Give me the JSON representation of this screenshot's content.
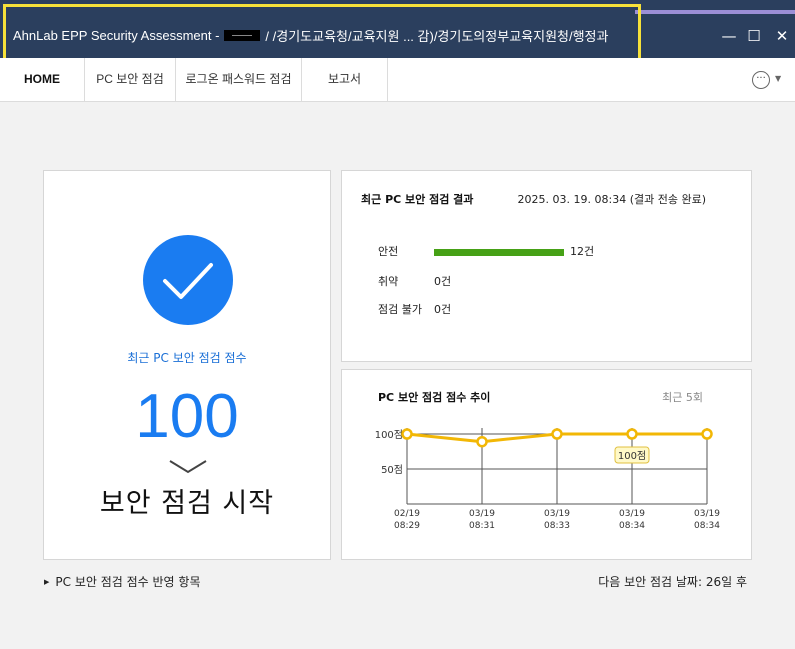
{
  "window": {
    "title_prefix": "AhnLab EPP Security Assessment -",
    "title_suffix": "/ /경기도교육청/교육지원 ... 감)/경기도의정부교육지원청/행정과",
    "minimize_glyph": "—",
    "maximize_glyph": "☐",
    "close_glyph": "✕"
  },
  "tabs": [
    {
      "label": "HOME"
    },
    {
      "label": "PC 보안 점검"
    },
    {
      "label": "로그온 패스워드 점검"
    },
    {
      "label": "보고서"
    }
  ],
  "more_menu": {
    "glyph": "···",
    "caret": "▼"
  },
  "score_panel": {
    "label": "최근 PC 보안 점검 점수",
    "score": "100",
    "start_button": "보안 점검 시작"
  },
  "results_panel": {
    "title": "최근 PC 보안 점검 결과",
    "date": "2025. 03. 19. 08:34 (결과 전송 완료)",
    "rows": [
      {
        "label": "안전",
        "count": "12건",
        "value": 12
      },
      {
        "label": "취약",
        "count": "0건",
        "value": 0
      },
      {
        "label": "점검 불가",
        "count": "0건",
        "value": 0
      }
    ]
  },
  "trend_panel": {
    "title": "PC 보안 점검 점수 추이",
    "recent": "최근 5회",
    "tooltip": "100점"
  },
  "chart_data": {
    "type": "line",
    "title": "PC 보안 점검 점수 추이",
    "x": [
      [
        "02/19",
        "08:29"
      ],
      [
        "03/19",
        "08:31"
      ],
      [
        "03/19",
        "08:33"
      ],
      [
        "03/19",
        "08:34"
      ],
      [
        "03/19",
        "08:34"
      ]
    ],
    "values": [
      100,
      89,
      100,
      100,
      100
    ],
    "ylim": [
      0,
      100
    ],
    "yticks": [
      {
        "value": 100,
        "label": "100점"
      },
      {
        "value": 50,
        "label": "50점"
      }
    ],
    "line_color": "#f2b705",
    "grid": true
  },
  "footer": {
    "left": "PC 보안 점검 점수 반영 항목",
    "right": "다음 보안 점검 날짜: 26일 후"
  },
  "colors": {
    "accent": "#1a7cf1",
    "safe_bar": "#46a116",
    "titlebar": "#2b3f5e",
    "highlight": "#f6e13a"
  }
}
